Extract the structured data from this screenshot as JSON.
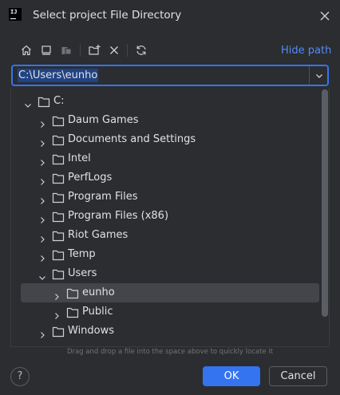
{
  "window": {
    "title": "Select project File Directory"
  },
  "toolbar": {
    "icons": [
      "home-icon",
      "desktop-icon",
      "project-folder-icon",
      "new-folder-icon",
      "delete-icon",
      "refresh-icon"
    ],
    "hide_path_label": "Hide path"
  },
  "path": {
    "value": "C:\\Users\\eunho"
  },
  "tree": {
    "root": {
      "label": "C:"
    },
    "items": [
      {
        "label": "Daum Games"
      },
      {
        "label": "Documents and Settings"
      },
      {
        "label": "Intel"
      },
      {
        "label": "PerfLogs"
      },
      {
        "label": "Program Files"
      },
      {
        "label": "Program Files (x86)"
      },
      {
        "label": "Riot Games"
      },
      {
        "label": "Temp"
      },
      {
        "label": "Users"
      },
      {
        "label": "eunho"
      },
      {
        "label": "Public"
      },
      {
        "label": "Windows"
      }
    ]
  },
  "hint": "Drag and drop a file into the space above to quickly locate it",
  "footer": {
    "help_label": "?",
    "ok_label": "OK",
    "cancel_label": "Cancel"
  },
  "colors": {
    "accent": "#3574f0",
    "link": "#548af7",
    "background": "#2b2d30",
    "selection": "#43454a"
  }
}
